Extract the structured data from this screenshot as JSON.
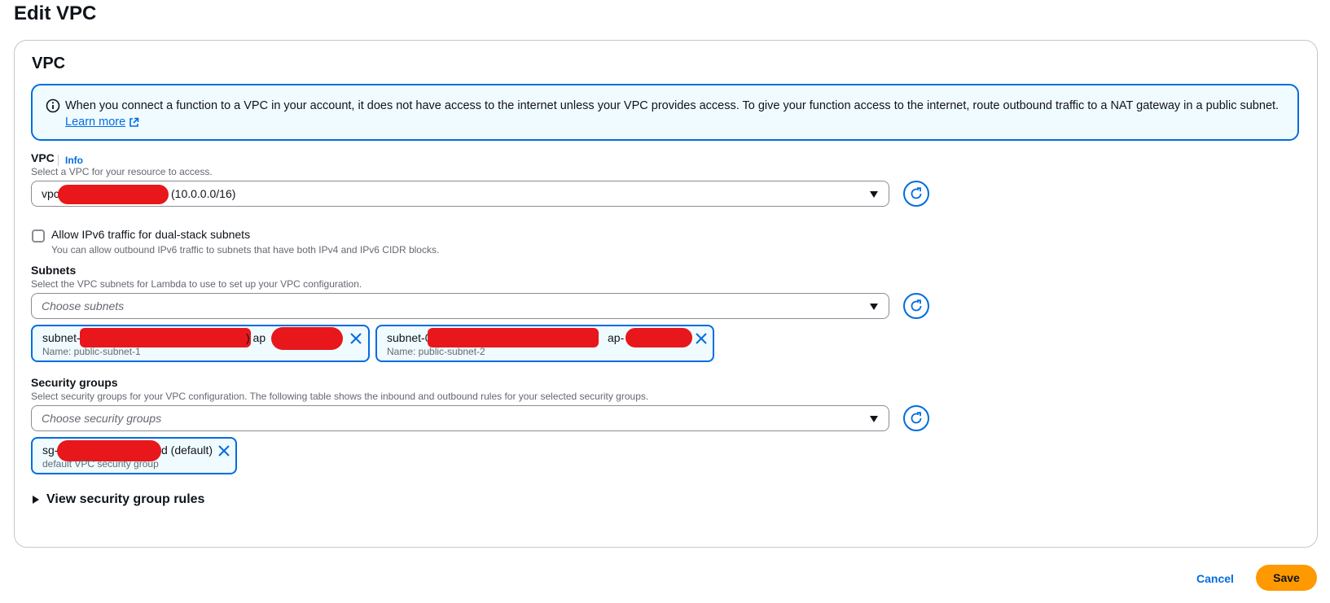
{
  "page": {
    "title": "Edit VPC"
  },
  "vpc_section": {
    "title": "VPC",
    "alert": {
      "text": "When you connect a function to a VPC in your account, it does not have access to the internet unless your VPC provides access. To give your function access to the internet, route outbound traffic to a NAT gateway in a public subnet.",
      "link": "Learn more",
      "icon": "info-icon"
    },
    "vpc_field": {
      "label": "VPC",
      "info": "Info",
      "description": "Select a VPC for your resource to access.",
      "value_prefix": "vpc",
      "value_suffix": "(10.0.0.0/16)"
    },
    "ipv6": {
      "label": "Allow IPv6 traffic for dual-stack subnets",
      "description": "You can allow outbound IPv6 traffic to subnets that have both IPv4 and IPv6 CIDR blocks.",
      "checked": false
    },
    "subnets": {
      "label": "Subnets",
      "description": "Select the VPC subnets for Lambda to use to set up your VPC configuration.",
      "placeholder": "Choose subnets",
      "tokens": [
        {
          "id_prefix": "subnet-",
          "az_prefix": ") ap",
          "name": "Name: public-subnet-1"
        },
        {
          "id_prefix": "subnet-0",
          "az_prefix": "ap-",
          "name": "Name: public-subnet-2"
        }
      ]
    },
    "security_groups": {
      "label": "Security groups",
      "description": "Select security groups for your VPC configuration. The following table shows the inbound and outbound rules for your selected security groups.",
      "placeholder": "Choose security groups",
      "tokens": [
        {
          "id_prefix": "sg-",
          "suffix": "d (default)",
          "name": "default VPC security group"
        }
      ]
    },
    "expander": "View security group rules"
  },
  "actions": {
    "cancel": "Cancel",
    "save": "Save"
  },
  "colors": {
    "accent": "#006ce0",
    "primary_button": "#ff9900",
    "redaction": "#e8171c",
    "alert_bg": "#f0fbff"
  }
}
